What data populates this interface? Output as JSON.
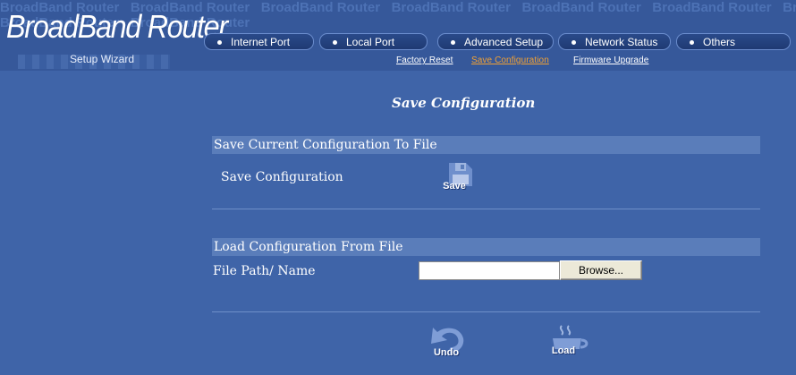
{
  "header": {
    "background_text": "BroadBand Router",
    "brand_title": "BroadBand Router",
    "brand_subtitle": "Setup Wizard",
    "tabs": [
      {
        "label": "Internet Port"
      },
      {
        "label": "Local Port"
      },
      {
        "label": "Advanced Setup"
      },
      {
        "label": "Network Status"
      },
      {
        "label": "Others"
      }
    ],
    "subnav": [
      {
        "label": "Factory Reset",
        "active": false
      },
      {
        "label": "Save Configuration",
        "active": true
      },
      {
        "label": "Firmware Upgrade",
        "active": false
      }
    ]
  },
  "main": {
    "title": "Save Configuration",
    "save_section": {
      "header": "Save Current Configuration To File",
      "label": "Save Configuration",
      "button_caption": "Save",
      "button_icon": "save-icon"
    },
    "load_section": {
      "header": "Load Configuration From File",
      "label": "File Path/ Name",
      "file_value": "",
      "browse_label": "Browse..."
    },
    "actions": {
      "undo_caption": "Undo",
      "undo_icon": "undo-icon",
      "load_caption": "Load",
      "load_icon": "load-icon"
    }
  },
  "colors": {
    "background": "#3f64a8",
    "header_background": "#36589a",
    "section_bar": "#5a7dba",
    "active_link": "#f2a133"
  }
}
